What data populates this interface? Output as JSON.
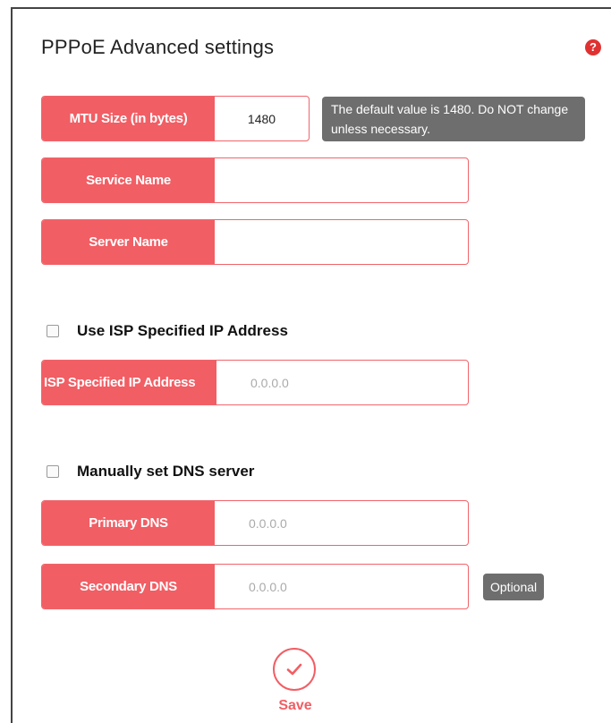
{
  "title": "PPPoE Advanced settings",
  "help_glyph": "?",
  "fields": {
    "mtu": {
      "label": "MTU Size (in bytes)",
      "value": "1480"
    },
    "service_name": {
      "label": "Service Name",
      "value": ""
    },
    "server_name": {
      "label": "Server Name",
      "value": ""
    },
    "isp_ip": {
      "label": "ISP Specified IP Address",
      "placeholder": "0.0.0.0"
    },
    "primary_dns": {
      "label": "Primary DNS",
      "placeholder": "0.0.0.0"
    },
    "secondary_dns": {
      "label": "Secondary DNS",
      "placeholder": "0.0.0.0"
    }
  },
  "tips": {
    "mtu": "The default value is 1480. Do NOT change unless necessary.",
    "secondary_dns": "Optional"
  },
  "checkboxes": {
    "use_isp_ip": {
      "label": "Use ISP Specified IP Address",
      "checked": false
    },
    "manual_dns": {
      "label": "Manually set DNS server",
      "checked": false
    }
  },
  "save": {
    "label": "Save",
    "icon": "checkmark-icon"
  },
  "colors": {
    "accent": "#f15e64",
    "tip_bg": "#6e6e6e",
    "help": "#e03131"
  }
}
